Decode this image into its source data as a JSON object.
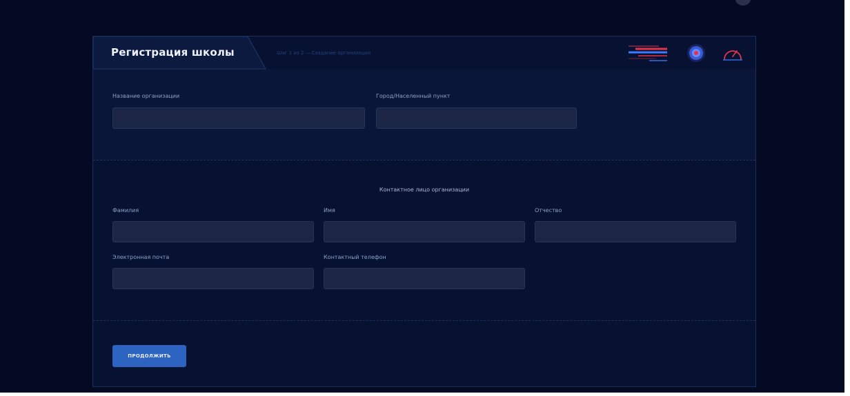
{
  "header": {
    "title": "Регистрация школы",
    "step_text": "Шаг 1 из 2 — Создание организации"
  },
  "organization": {
    "name_label": "Название организации",
    "name_value": "",
    "city_label": "Город/Населенный пункт",
    "city_value": ""
  },
  "contact": {
    "heading": "Контактное лицо организации",
    "last_name_label": "Фамилия",
    "last_name_value": "",
    "first_name_label": "Имя",
    "first_name_value": "",
    "patronymic_label": "Отчество",
    "patronymic_value": "",
    "email_label": "Электронная почта",
    "email_value": "",
    "phone_label": "Контактный телефон",
    "phone_value": ""
  },
  "actions": {
    "continue_label": "ПРОДОЛЖИТЬ"
  },
  "icons": {
    "menu": "hamburger-menu-icon",
    "avatar": "profile-avatar-icon",
    "speed": "speedometer-icon"
  },
  "colors": {
    "background": "#050a24",
    "card": "#071233",
    "input": "#1b2646",
    "accent": "#2d64c2",
    "icon_red": "#e8324a",
    "icon_blue": "#3a7bff"
  }
}
